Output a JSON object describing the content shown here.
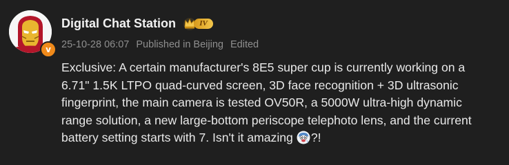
{
  "post": {
    "author": {
      "name": "Digital Chat Station",
      "avatar_icon": "iron-man-avatar-icon",
      "verified_icon": "verified-v-icon",
      "verified_label": "v",
      "vip_level": "IV",
      "vip_icon": "crown-icon"
    },
    "meta": {
      "timestamp": "25-10-28 06:07",
      "location": "Published in Beijing",
      "edited": "Edited"
    },
    "content": {
      "lines": [
        "Exclusive: A certain manufacturer's 8E5 super cup is currently working on a",
        "6.71\" 1.5K LTPO quad-curved screen, 3D face recognition + 3D ultrasonic",
        "fingerprint, the main camera is tested OV50R, a 5000W ultra-high dynamic",
        "range solution, a new large-bottom periscope telephoto lens, and the current",
        "battery setting starts with 7. Isn't it amazing"
      ],
      "emoji_icon": "doge-emoji-icon",
      "ending": "?!"
    },
    "colors": {
      "background": "#1f1f1f",
      "text": "#e8e8e8",
      "meta_text": "#8f8f8f",
      "verified_orange": "#f08a1a",
      "vip_gold": "#f3c64b"
    }
  }
}
